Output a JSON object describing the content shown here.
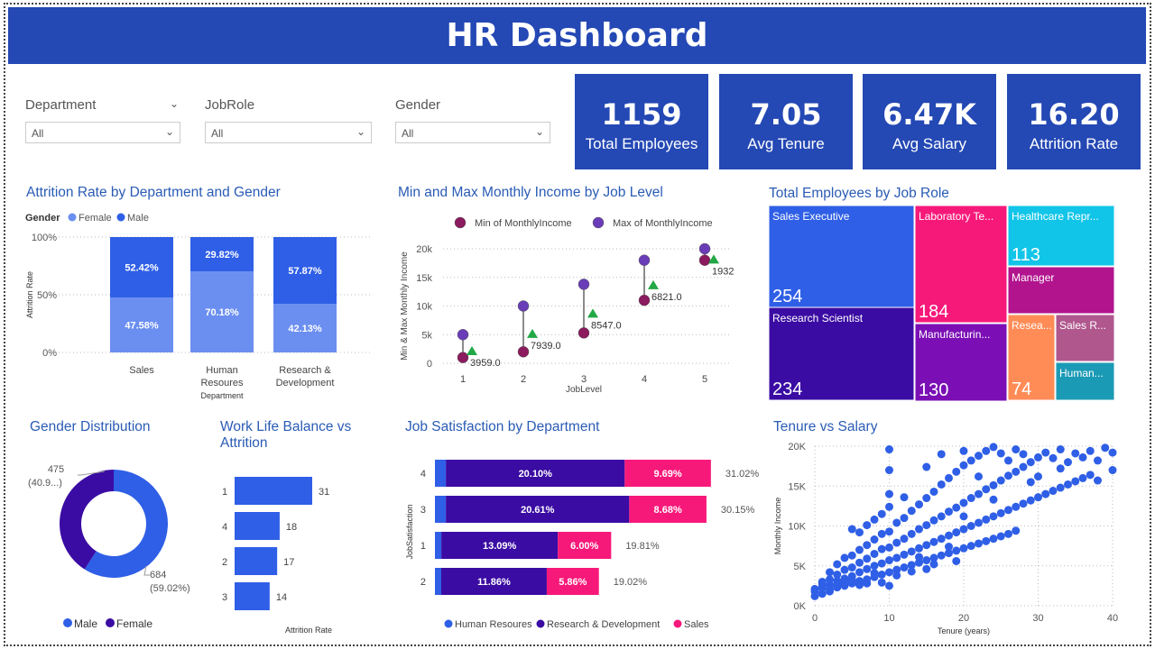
{
  "title": "HR Dashboard",
  "slicers": [
    {
      "label": "Department",
      "value": "All"
    },
    {
      "label": "JobRole",
      "value": "All"
    },
    {
      "label": "Gender",
      "value": "All"
    }
  ],
  "kpis": [
    {
      "value": "1159",
      "label": "Total Employees"
    },
    {
      "value": "7.05",
      "label": "Avg Tenure"
    },
    {
      "value": "6.47K",
      "label": "Avg Salary"
    },
    {
      "value": "16.20",
      "label": "Attrition Rate"
    }
  ],
  "colors": {
    "brand": "#2448b4",
    "female": "#6b8ff0",
    "male": "#2f5fe6",
    "purple": "#3a0ca3",
    "pink": "#f7197a",
    "minDot": "#8b1a5e",
    "maxDot": "#6a3db8",
    "green": "#22a845"
  },
  "chart_data": [
    {
      "type": "bar",
      "title": "Attrition Rate by Department and Gender",
      "legend_title": "Gender",
      "stacked": "100%",
      "categories": [
        "Sales",
        "Human Resoures",
        "Research & Development"
      ],
      "category_lines": [
        [
          "Sales"
        ],
        [
          "Human",
          "Resoures"
        ],
        [
          "Research &",
          "Development"
        ]
      ],
      "series": [
        {
          "name": "Female",
          "values": [
            47.58,
            70.18,
            42.13
          ],
          "labels": [
            "47.58%",
            "70.18%",
            "42.13%"
          ]
        },
        {
          "name": "Male",
          "values": [
            52.42,
            29.82,
            57.87
          ],
          "labels": [
            "52.42%",
            "29.82%",
            "57.87%"
          ]
        }
      ],
      "xlabel": "Department",
      "ylabel": "Attrition Rate",
      "yticks": [
        "0%",
        "50%",
        "100%"
      ],
      "legend": "top-left"
    },
    {
      "type": "scatter",
      "title": "Min and Max Monthly Income by Job Level",
      "x": [
        1,
        2,
        3,
        4,
        5
      ],
      "series": [
        {
          "name": "Min of MonthlyIncome",
          "values": [
            1000,
            2000,
            5300,
            11000,
            18000
          ]
        },
        {
          "name": "Max of MonthlyIncome",
          "values": [
            5000,
            10000,
            13800,
            18000,
            20000
          ]
        }
      ],
      "diff_labels": [
        "3959.0",
        "7939.0",
        "8547.0",
        "6821.0",
        "1932"
      ],
      "xlabel": "JobLevel",
      "ylabel": "Min & Max Monthly Income",
      "yticks": [
        "0",
        "5k",
        "10k",
        "15k",
        "20k"
      ],
      "ylim": [
        0,
        20000
      ],
      "legend": "top"
    },
    {
      "type": "heatmap",
      "subtype": "treemap",
      "title": "Total Employees by Job Role",
      "items": [
        {
          "name": "Sales Executive",
          "value": "254",
          "color": "#2f5fe6"
        },
        {
          "name": "Research Scientist",
          "value": "234",
          "color": "#3a0ca3"
        },
        {
          "name": "Laboratory Te...",
          "value": "184",
          "color": "#f7197a"
        },
        {
          "name": "Manufacturin...",
          "value": "130",
          "color": "#7b0fb5"
        },
        {
          "name": "Healthcare Repr...",
          "value": "113",
          "color": "#11c5e8"
        },
        {
          "name": "Manager",
          "value": "",
          "color": "#b2148e"
        },
        {
          "name": "Resea...",
          "value": "74",
          "color": "#ff8c57"
        },
        {
          "name": "Sales R...",
          "value": "",
          "color": "#b0578e"
        },
        {
          "name": "Human...",
          "value": "",
          "color": "#1b9ab5"
        }
      ]
    },
    {
      "type": "pie",
      "subtype": "donut",
      "title": "Gender Distribution",
      "slices": [
        {
          "name": "Male",
          "value": 684,
          "label": [
            "684",
            "(59.02%)"
          ]
        },
        {
          "name": "Female",
          "value": 475,
          "label": [
            "475",
            "(40.9...)"
          ]
        }
      ],
      "legend": "bottom"
    },
    {
      "type": "bar",
      "orientation": "horizontal",
      "title": "Work Life Balance vs Attrition",
      "title_lines": [
        "Work Life Balance vs",
        "Attrition"
      ],
      "categories": [
        "1",
        "4",
        "2",
        "3"
      ],
      "values": [
        31,
        18,
        17,
        14
      ],
      "xlabel": "Attrition Rate"
    },
    {
      "type": "bar",
      "orientation": "horizontal",
      "stacked": true,
      "title": "Job Satisfaction by Department",
      "categories": [
        "4",
        "3",
        "1",
        "2"
      ],
      "series": [
        {
          "name": "Human Resoures",
          "values": [
            1.23,
            1.23,
            0.72,
            0.71
          ],
          "labels": [
            "",
            "",
            "",
            ""
          ]
        },
        {
          "name": "Research & Development",
          "values": [
            20.1,
            20.61,
            13.09,
            11.86
          ],
          "labels": [
            "20.10%",
            "20.61%",
            "13.09%",
            "11.86%"
          ]
        },
        {
          "name": "Sales",
          "values": [
            9.69,
            8.68,
            6.0,
            5.86
          ],
          "labels": [
            "9.69%",
            "8.68%",
            "6.00%",
            "5.86%"
          ]
        }
      ],
      "totals": [
        "31.02%",
        "30.15%",
        "19.81%",
        "19.02%"
      ],
      "ylabel": "JobSatisfaction",
      "legend": "bottom"
    },
    {
      "type": "scatter",
      "title": "Tenure vs Salary",
      "xlabel": "Tenure (years)",
      "ylabel": "Monthly Income",
      "xticks": [
        "0",
        "10",
        "20",
        "30",
        "40"
      ],
      "xlim": [
        0,
        40
      ],
      "yticks": [
        "0K",
        "5K",
        "10K",
        "15K",
        "20K"
      ],
      "ylim": [
        0,
        20000
      ],
      "points": [
        [
          0,
          1200
        ],
        [
          0,
          2100
        ],
        [
          0,
          1800
        ],
        [
          1,
          1500
        ],
        [
          1,
          2400
        ],
        [
          1,
          3000
        ],
        [
          1,
          2200
        ],
        [
          1,
          2800
        ],
        [
          2,
          2000
        ],
        [
          2,
          2600
        ],
        [
          2,
          3300
        ],
        [
          2,
          1800
        ],
        [
          2,
          4200
        ],
        [
          3,
          2300
        ],
        [
          3,
          3100
        ],
        [
          3,
          3900
        ],
        [
          3,
          5200
        ],
        [
          3,
          2700
        ],
        [
          4,
          2500
        ],
        [
          4,
          3400
        ],
        [
          4,
          4500
        ],
        [
          4,
          6000
        ],
        [
          4,
          2900
        ],
        [
          5,
          2800
        ],
        [
          5,
          3700
        ],
        [
          5,
          4800
        ],
        [
          5,
          6300
        ],
        [
          5,
          9600
        ],
        [
          5,
          3200
        ],
        [
          6,
          3100
        ],
        [
          6,
          4200
        ],
        [
          6,
          5400
        ],
        [
          6,
          7000
        ],
        [
          6,
          2600
        ],
        [
          6,
          9200
        ],
        [
          7,
          3300
        ],
        [
          7,
          4600
        ],
        [
          7,
          5900
        ],
        [
          7,
          7600
        ],
        [
          7,
          10100
        ],
        [
          7,
          2800
        ],
        [
          8,
          3600
        ],
        [
          8,
          5000
        ],
        [
          8,
          6500
        ],
        [
          8,
          8300
        ],
        [
          8,
          10800
        ],
        [
          8,
          4100
        ],
        [
          9,
          3900
        ],
        [
          9,
          5300
        ],
        [
          9,
          7100
        ],
        [
          9,
          9000
        ],
        [
          9,
          11500
        ],
        [
          9,
          2900
        ],
        [
          10,
          4200
        ],
        [
          10,
          5700
        ],
        [
          10,
          7300
        ],
        [
          10,
          9300
        ],
        [
          10,
          12400
        ],
        [
          10,
          19600
        ],
        [
          10,
          17000
        ],
        [
          10,
          2500
        ],
        [
          10,
          14000
        ],
        [
          11,
          4500
        ],
        [
          11,
          6000
        ],
        [
          11,
          7900
        ],
        [
          11,
          10400
        ],
        [
          11,
          3800
        ],
        [
          12,
          4800
        ],
        [
          12,
          6400
        ],
        [
          12,
          8400
        ],
        [
          12,
          11000
        ],
        [
          12,
          13600
        ],
        [
          13,
          5100
        ],
        [
          13,
          6800
        ],
        [
          13,
          9000
        ],
        [
          13,
          11900
        ],
        [
          13,
          4300
        ],
        [
          14,
          5400
        ],
        [
          14,
          7200
        ],
        [
          14,
          9600
        ],
        [
          14,
          12700
        ],
        [
          14,
          6100
        ],
        [
          15,
          5700
        ],
        [
          15,
          7600
        ],
        [
          15,
          10100
        ],
        [
          15,
          13500
        ],
        [
          15,
          17400
        ],
        [
          15,
          4600
        ],
        [
          16,
          6000
        ],
        [
          16,
          8000
        ],
        [
          16,
          10700
        ],
        [
          16,
          14300
        ],
        [
          16,
          5200
        ],
        [
          17,
          6300
        ],
        [
          17,
          8400
        ],
        [
          17,
          11200
        ],
        [
          17,
          15200
        ],
        [
          17,
          19000
        ],
        [
          18,
          6600
        ],
        [
          18,
          8800
        ],
        [
          18,
          11800
        ],
        [
          18,
          16000
        ],
        [
          18,
          7400
        ],
        [
          19,
          6900
        ],
        [
          19,
          9200
        ],
        [
          19,
          12300
        ],
        [
          19,
          16800
        ],
        [
          19,
          5600
        ],
        [
          20,
          7200
        ],
        [
          20,
          9600
        ],
        [
          20,
          12900
        ],
        [
          20,
          17600
        ],
        [
          20,
          19400
        ],
        [
          20,
          11200
        ],
        [
          21,
          7500
        ],
        [
          21,
          10000
        ],
        [
          21,
          13500
        ],
        [
          21,
          18200
        ],
        [
          22,
          7800
        ],
        [
          22,
          10400
        ],
        [
          22,
          14000
        ],
        [
          22,
          18800
        ],
        [
          22,
          16200
        ],
        [
          23,
          8100
        ],
        [
          23,
          10800
        ],
        [
          23,
          14600
        ],
        [
          23,
          19400
        ],
        [
          24,
          8400
        ],
        [
          24,
          11200
        ],
        [
          24,
          15100
        ],
        [
          24,
          19900
        ],
        [
          24,
          13300
        ],
        [
          25,
          8700
        ],
        [
          25,
          11600
        ],
        [
          25,
          15700
        ],
        [
          25,
          19100
        ],
        [
          26,
          9000
        ],
        [
          26,
          12000
        ],
        [
          26,
          16300
        ],
        [
          26,
          18200
        ],
        [
          27,
          9400
        ],
        [
          27,
          12400
        ],
        [
          27,
          16800
        ],
        [
          27,
          19600
        ],
        [
          28,
          12800
        ],
        [
          28,
          17400
        ],
        [
          28,
          19000
        ],
        [
          29,
          13200
        ],
        [
          29,
          18000
        ],
        [
          29,
          15500
        ],
        [
          30,
          13600
        ],
        [
          30,
          18600
        ],
        [
          30,
          16200
        ],
        [
          31,
          14000
        ],
        [
          31,
          19200
        ],
        [
          32,
          14400
        ],
        [
          32,
          18500
        ],
        [
          33,
          14800
        ],
        [
          33,
          19600
        ],
        [
          33,
          17200
        ],
        [
          34,
          15200
        ],
        [
          34,
          18000
        ],
        [
          35,
          15600
        ],
        [
          35,
          19100
        ],
        [
          36,
          16000
        ],
        [
          36,
          18600
        ],
        [
          37,
          16400
        ],
        [
          37,
          19400
        ],
        [
          38,
          15700
        ],
        [
          38,
          18200
        ],
        [
          39,
          19800
        ],
        [
          40,
          17000
        ],
        [
          40,
          19200
        ]
      ]
    }
  ]
}
